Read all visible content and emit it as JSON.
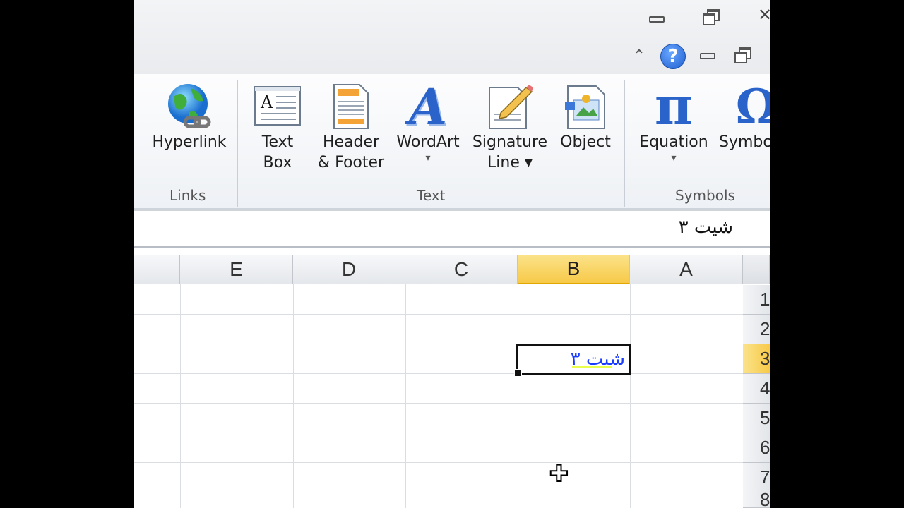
{
  "window": {
    "minimize_glyph": "",
    "restore_glyph": "",
    "close_glyph": "✕",
    "help_glyph": "?",
    "collapse_ribbon_glyph": "⌃"
  },
  "ribbon": {
    "groups": [
      {
        "label": "Links"
      },
      {
        "label": "Text"
      },
      {
        "label": "Symbols"
      }
    ],
    "buttons": {
      "hyperlink": {
        "line1": "Hyperlink",
        "icon": "globe-link-icon"
      },
      "textbox": {
        "line1": "Text",
        "line2": "Box",
        "icon": "text-box-icon"
      },
      "header_footer": {
        "line1": "Header",
        "line2": "& Footer",
        "icon": "header-footer-icon"
      },
      "wordart": {
        "line1": "WordArt",
        "drop": "▾",
        "icon": "wordart-icon",
        "glyph": "A"
      },
      "signature": {
        "line1": "Signature",
        "line2": "Line ▾",
        "icon": "signature-line-icon"
      },
      "object": {
        "line1": "Object",
        "icon": "object-icon"
      },
      "equation": {
        "line1": "Equation",
        "drop": "▾",
        "icon": "pi-icon",
        "glyph": "π"
      },
      "symbol": {
        "line1": "Symbo",
        "icon": "omega-icon",
        "glyph": "Ω"
      }
    }
  },
  "formula_bar": {
    "value": "شیت ۳"
  },
  "grid": {
    "columns": [
      "E",
      "D",
      "C",
      "B",
      "A"
    ],
    "active_column": "B",
    "rows": [
      "1",
      "2",
      "3",
      "4",
      "5",
      "6",
      "7",
      "8"
    ],
    "active_row": "3",
    "active_cell": {
      "ref": "B3",
      "value": "شیت ۳"
    }
  },
  "colors": {
    "accent_header": "#f7c948",
    "cell_text": "#1a3cff"
  }
}
